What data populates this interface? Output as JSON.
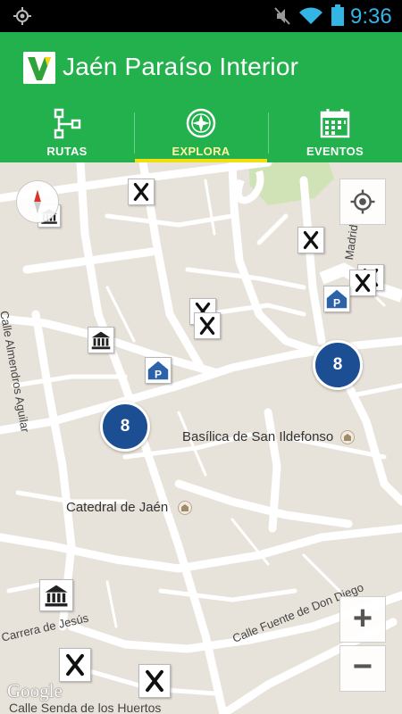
{
  "status_bar": {
    "time": "9:36"
  },
  "header": {
    "app_title": "Jaén Paraíso Interior"
  },
  "tabs": [
    {
      "label": "RUTAS",
      "icon": "route-icon",
      "active": false
    },
    {
      "label": "EXPLORA",
      "icon": "compass-icon",
      "active": true
    },
    {
      "label": "EVENTOS",
      "icon": "calendar-icon",
      "active": false
    }
  ],
  "map": {
    "places": [
      {
        "name": "Basílica de San Ildefonso"
      },
      {
        "name": "Catedral de Jaén"
      }
    ],
    "streets": [
      {
        "name": "Calle Almendros Aguilar"
      },
      {
        "name": "Calle Fuente de Don Diego"
      },
      {
        "name": "Carrera de Jesús"
      },
      {
        "name": "Madrid"
      },
      {
        "name": "Calle Senda de los Huertos"
      }
    ],
    "clusters": [
      {
        "count": "8"
      },
      {
        "count": "8"
      }
    ],
    "attribution": "Google",
    "zoom_in_label": "+",
    "zoom_out_label": "−"
  },
  "colors": {
    "header_bg": "#22b14c",
    "active_tab_indicator": "#f2e00e",
    "cluster_bg": "#1c4e93",
    "status_icons": "#33b5e5"
  }
}
